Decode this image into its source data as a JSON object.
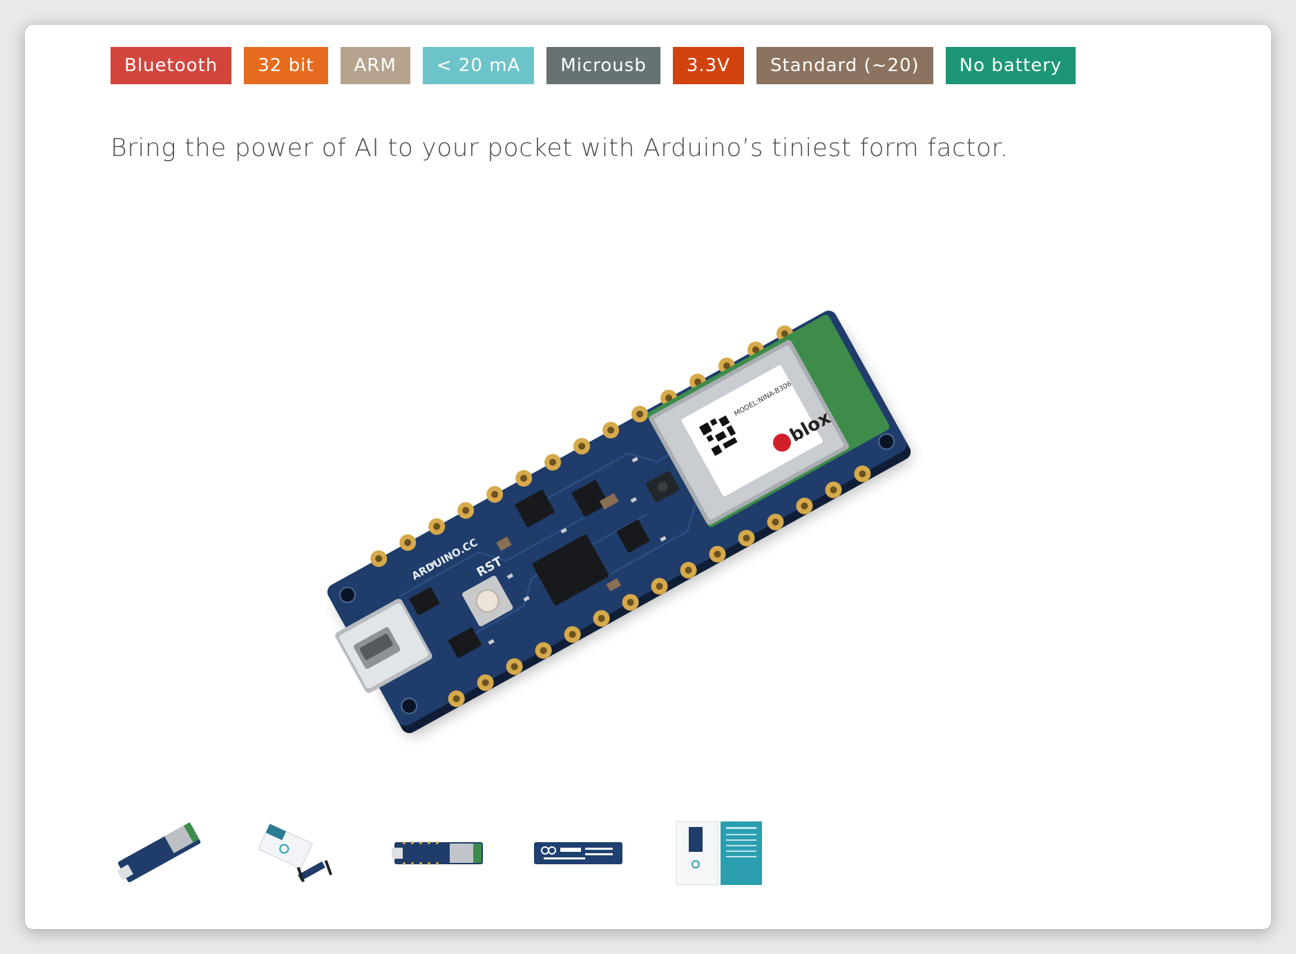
{
  "tags": [
    {
      "label": "Bluetooth",
      "color": "#d2453d"
    },
    {
      "label": "32 bit",
      "color": "#e56c1f"
    },
    {
      "label": "ARM",
      "color": "#b5a38e"
    },
    {
      "label": "< 20 mA",
      "color": "#6cc4c9"
    },
    {
      "label": "Microusb",
      "color": "#667274"
    },
    {
      "label": "3.3V",
      "color": "#d24310"
    },
    {
      "label": "Standard (~20)",
      "color": "#8b735f"
    },
    {
      "label": "No battery",
      "color": "#1c9676"
    }
  ],
  "tagline": "Bring the power of AI to your pocket with Arduino’s tiniest form factor.",
  "main_image": {
    "silkscreen_arduino": "ARDUINO.CC",
    "silkscreen_rst": "RST",
    "module_brand": "blox",
    "module_model": "MODEL:NINA-B306"
  },
  "thumbnails": [
    {
      "name": "thumbnail-board-angled"
    },
    {
      "name": "thumbnail-board-packaging"
    },
    {
      "name": "thumbnail-board-top"
    },
    {
      "name": "thumbnail-board-bottom"
    },
    {
      "name": "thumbnail-box-and-card"
    }
  ]
}
